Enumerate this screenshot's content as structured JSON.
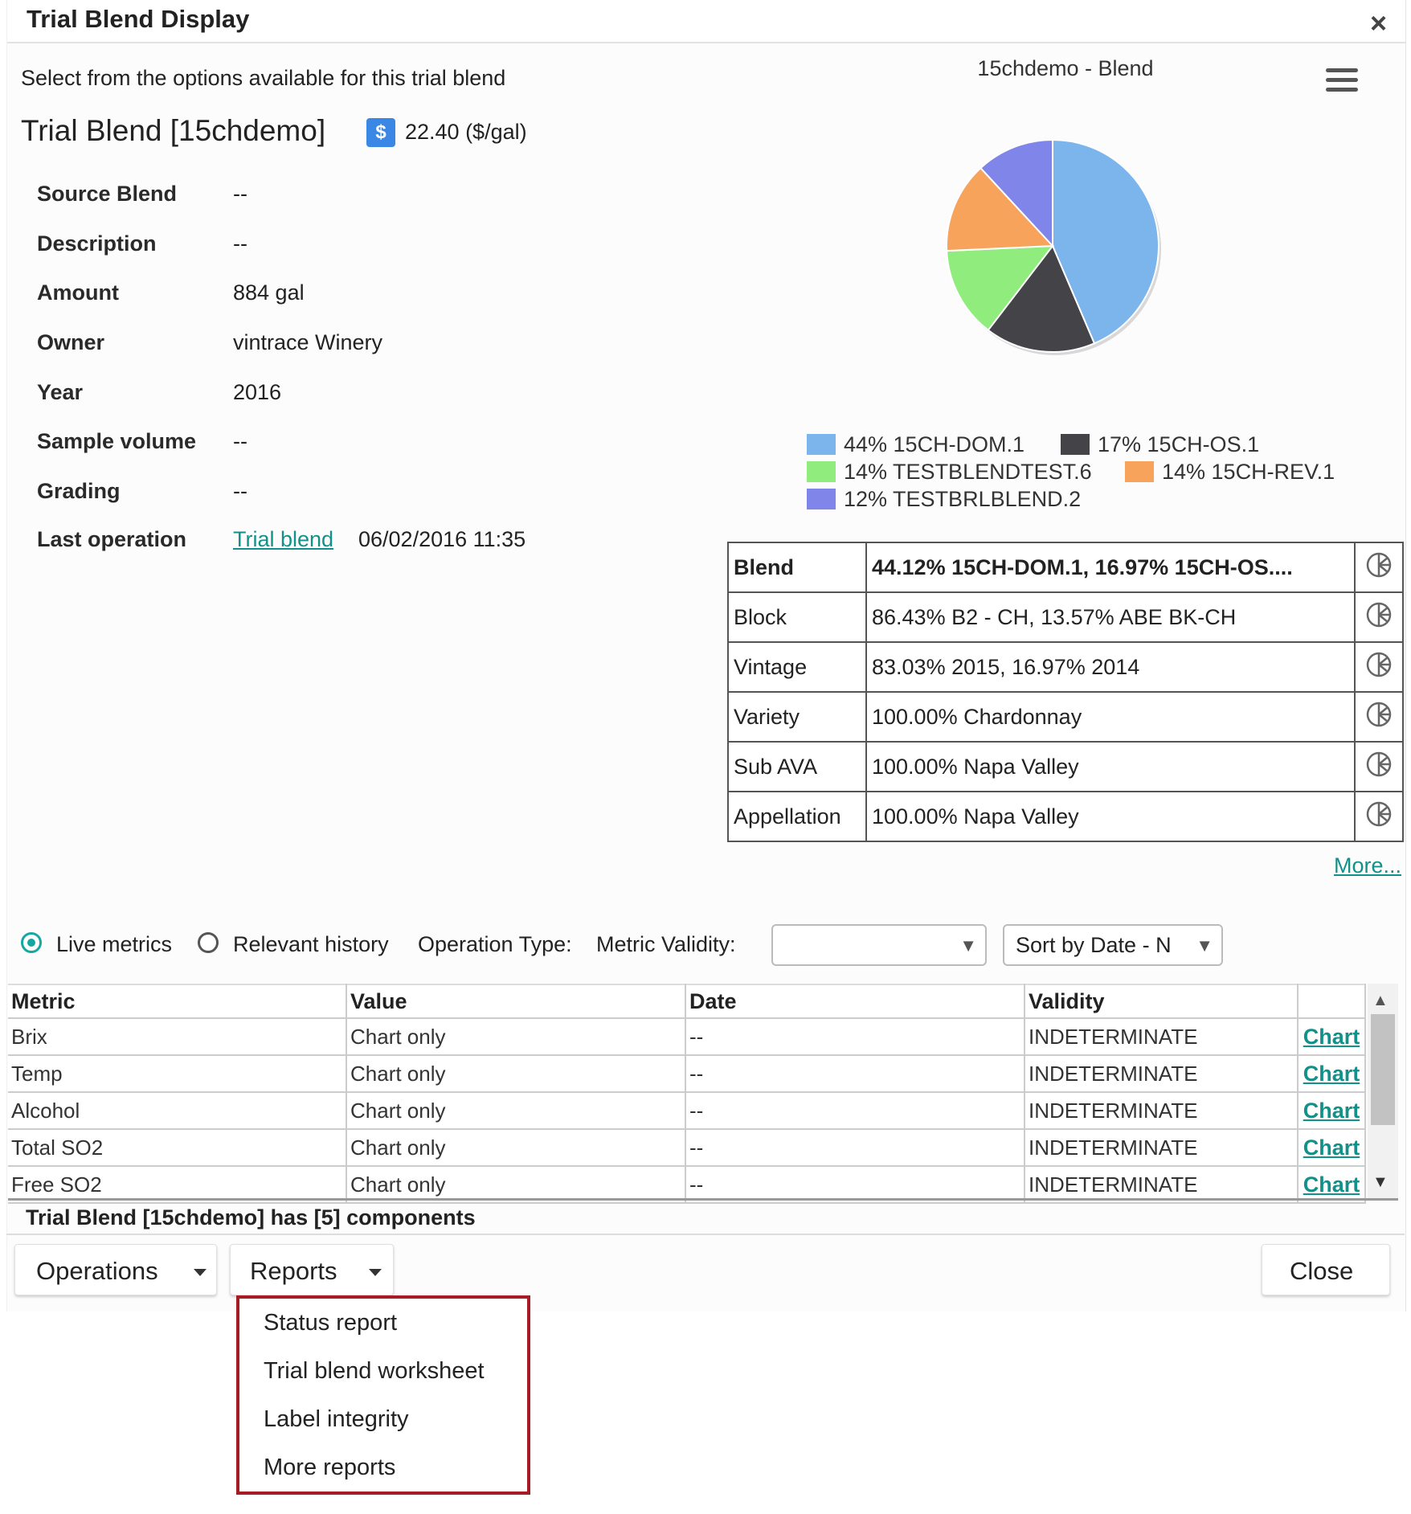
{
  "dialog": {
    "title": "Trial Blend Display",
    "close_icon": "×"
  },
  "header": {
    "instructions": "Select from the options available for this trial blend",
    "blend_title": "Trial Blend [15chdemo]",
    "price_icon": "$",
    "price": "22.40 ($/gal)"
  },
  "properties": [
    {
      "label": "Source Blend",
      "value": "--"
    },
    {
      "label": "Description",
      "value": "--"
    },
    {
      "label": "Amount",
      "value": "884 gal"
    },
    {
      "label": "Owner",
      "value": "vintrace Winery"
    },
    {
      "label": "Year",
      "value": "2016"
    },
    {
      "label": "Sample volume",
      "value": "--"
    },
    {
      "label": "Grading",
      "value": "--"
    }
  ],
  "last_operation": {
    "label": "Last operation",
    "link": "Trial blend",
    "date": "06/02/2016 11:35"
  },
  "chart_data": {
    "type": "pie",
    "title": "15chdemo - Blend",
    "slices": [
      {
        "label": "15CH-DOM.1",
        "percent": 44,
        "display": "44% 15CH-DOM.1",
        "color": "#7cb5ec"
      },
      {
        "label": "15CH-OS.1",
        "percent": 17,
        "display": "17% 15CH-OS.1",
        "color": "#434348"
      },
      {
        "label": "TESTBLENDTEST.6",
        "percent": 14,
        "display": "14% TESTBLENDTEST.6",
        "color": "#90ed7d"
      },
      {
        "label": "15CH-REV.1",
        "percent": 14,
        "display": "14% 15CH-REV.1",
        "color": "#f7a35c"
      },
      {
        "label": "TESTBRLBLEND.2",
        "percent": 12,
        "display": "12% TESTBRLBLEND.2",
        "color": "#8085e9"
      }
    ]
  },
  "composition": [
    {
      "key": "Blend",
      "value": "44.12% 15CH-DOM.1, 16.97% 15CH-OS....",
      "bold": true
    },
    {
      "key": "Block",
      "value": "86.43% B2 - CH, 13.57% ABE BK-CH",
      "bold": false
    },
    {
      "key": "Vintage",
      "value": "83.03% 2015, 16.97% 2014",
      "bold": false
    },
    {
      "key": "Variety",
      "value": "100.00% Chardonnay",
      "bold": false
    },
    {
      "key": "Sub AVA",
      "value": "100.00% Napa Valley",
      "bold": false
    },
    {
      "key": "Appellation",
      "value": "100.00% Napa Valley",
      "bold": false
    }
  ],
  "more_link": "More...",
  "filters": {
    "live_metrics": "Live metrics",
    "relevant_history": "Relevant history",
    "operation_type_label": "Operation Type:",
    "metric_validity_label": "Metric Validity:",
    "metric_validity_value": "",
    "sort_value": "Sort by Date - N"
  },
  "metrics_table": {
    "headers": [
      "Metric",
      "Value",
      "Date",
      "Validity",
      ""
    ],
    "rows": [
      {
        "metric": "Brix",
        "value": "Chart only",
        "date": "--",
        "validity": "INDETERMINATE",
        "action": "Chart"
      },
      {
        "metric": "Temp",
        "value": "Chart only",
        "date": "--",
        "validity": "INDETERMINATE",
        "action": "Chart"
      },
      {
        "metric": "Alcohol",
        "value": "Chart only",
        "date": "--",
        "validity": "INDETERMINATE",
        "action": "Chart"
      },
      {
        "metric": "Total SO2",
        "value": "Chart only",
        "date": "--",
        "validity": "INDETERMINATE",
        "action": "Chart"
      },
      {
        "metric": "Free SO2",
        "value": "Chart only",
        "date": "--",
        "validity": "INDETERMINATE",
        "action": "Chart"
      }
    ]
  },
  "summary": "Trial Blend [15chdemo] has [5] components",
  "footer": {
    "operations": "Operations",
    "reports": "Reports",
    "close": "Close"
  },
  "reports_menu": [
    "Status report",
    "Trial blend worksheet",
    "Label integrity",
    "More reports"
  ]
}
